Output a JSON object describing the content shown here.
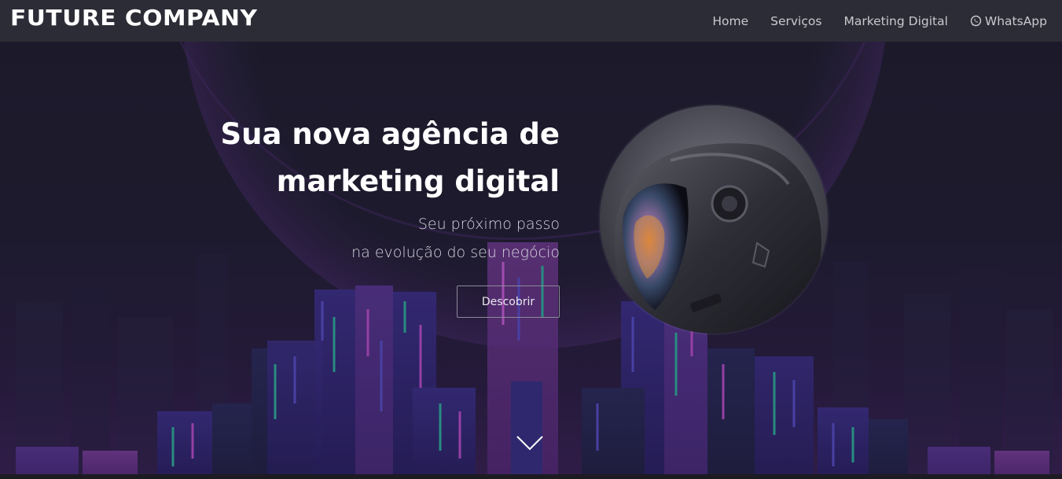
{
  "navbar": {
    "brand": "FUTURE COMPANY",
    "links": [
      {
        "label": "Home"
      },
      {
        "label": "Serviços"
      },
      {
        "label": "Marketing Digital"
      },
      {
        "label": "WhatsApp",
        "icon": "whatsapp-icon"
      }
    ]
  },
  "hero": {
    "title_line1": "Sua nova agência de",
    "title_line2": "marketing digital",
    "subtitle_line1": "Seu próximo passo",
    "subtitle_line2": "na evolução do seu negócio",
    "cta_label": "Descobrir",
    "scroll_icon": "chevron-down-icon",
    "image": "astronaut-helmet-image"
  },
  "colors": {
    "navbar_bg": "#2c2c36",
    "hero_bg": "#1f1d2e",
    "accent_purple": "#5b2a8a",
    "accent_teal": "#2fb5a0"
  }
}
